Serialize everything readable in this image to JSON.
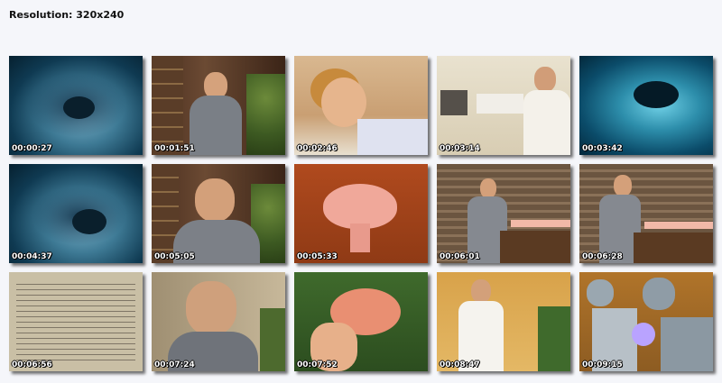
{
  "header": {
    "resolution_label": "Resolution: 320x240"
  },
  "thumbnails": [
    {
      "timestamp": "00:00:27",
      "scene": "ultrasound"
    },
    {
      "timestamp": "00:01:51",
      "scene": "man-office"
    },
    {
      "timestamp": "00:02:46",
      "scene": "woman-bed"
    },
    {
      "timestamp": "00:03:14",
      "scene": "clinic-exam"
    },
    {
      "timestamp": "00:03:42",
      "scene": "ultrasound-cyan"
    },
    {
      "timestamp": "00:04:37",
      "scene": "ultrasound"
    },
    {
      "timestamp": "00:05:05",
      "scene": "man-closeup"
    },
    {
      "timestamp": "00:05:33",
      "scene": "uterus-model"
    },
    {
      "timestamp": "00:06:01",
      "scene": "man-blinds"
    },
    {
      "timestamp": "00:06:28",
      "scene": "man-blinds-2"
    },
    {
      "timestamp": "00:06:56",
      "scene": "document-page"
    },
    {
      "timestamp": "00:07:24",
      "scene": "man-closeup-2"
    },
    {
      "timestamp": "00:07:52",
      "scene": "hand-model"
    },
    {
      "timestamp": "00:08:47",
      "scene": "lab-coat"
    },
    {
      "timestamp": "00:09:15",
      "scene": "surgery"
    }
  ]
}
